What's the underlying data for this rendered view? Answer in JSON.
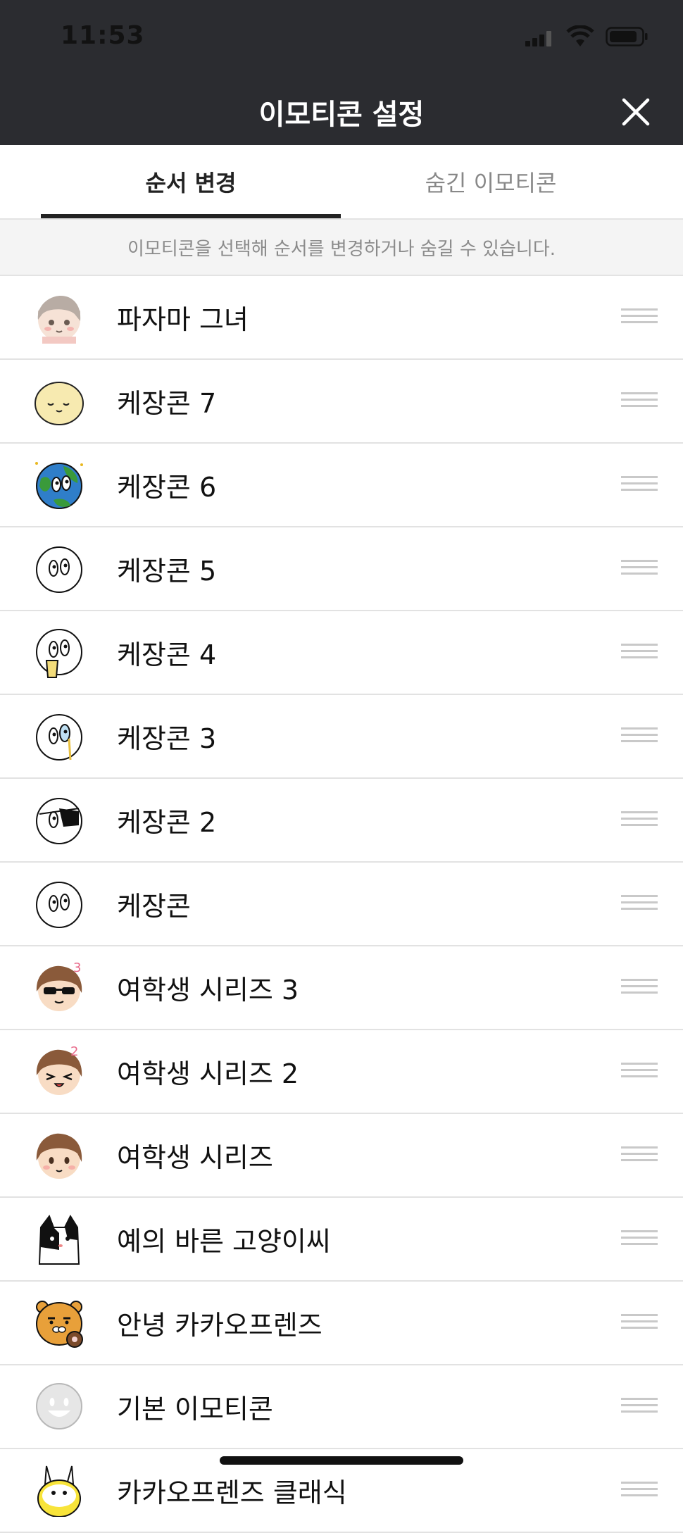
{
  "status_bar": {
    "time": "11:53"
  },
  "header": {
    "title": "이모티콘 설정"
  },
  "tabs": [
    {
      "label": "순서 변경",
      "active": true
    },
    {
      "label": "숨긴 이모티콘",
      "active": false
    }
  ],
  "notice": "이모티콘을 선택해 순서를 변경하거나 숨길 수 있습니다.",
  "emoticons": [
    {
      "name": "파자마 그녀",
      "icon": "pajama-girl-icon"
    },
    {
      "name": "케장콘 7",
      "icon": "yellow-blob-icon"
    },
    {
      "name": "케장콘 6",
      "icon": "earth-face-icon"
    },
    {
      "name": "케장콘 5",
      "icon": "kejang-face-icon"
    },
    {
      "name": "케장콘 4",
      "icon": "kejang-cup-icon"
    },
    {
      "name": "케장콘 3",
      "icon": "kejang-tear-icon"
    },
    {
      "name": "케장콘 2",
      "icon": "kejang-eyepatch-icon"
    },
    {
      "name": "케장콘",
      "icon": "kejang-face-icon"
    },
    {
      "name": "여학생 시리즈 3",
      "icon": "schoolgirl-sunglasses-icon"
    },
    {
      "name": "여학생 시리즈 2",
      "icon": "schoolgirl-wink-icon"
    },
    {
      "name": "여학생 시리즈",
      "icon": "schoolgirl-icon"
    },
    {
      "name": "예의 바른 고양이씨",
      "icon": "cat-icon"
    },
    {
      "name": "안녕 카카오프렌즈",
      "icon": "ryan-icon"
    },
    {
      "name": "기본 이모티콘",
      "icon": "smiley-icon"
    },
    {
      "name": "카카오프렌즈 클래식",
      "icon": "muzi-icon"
    }
  ]
}
